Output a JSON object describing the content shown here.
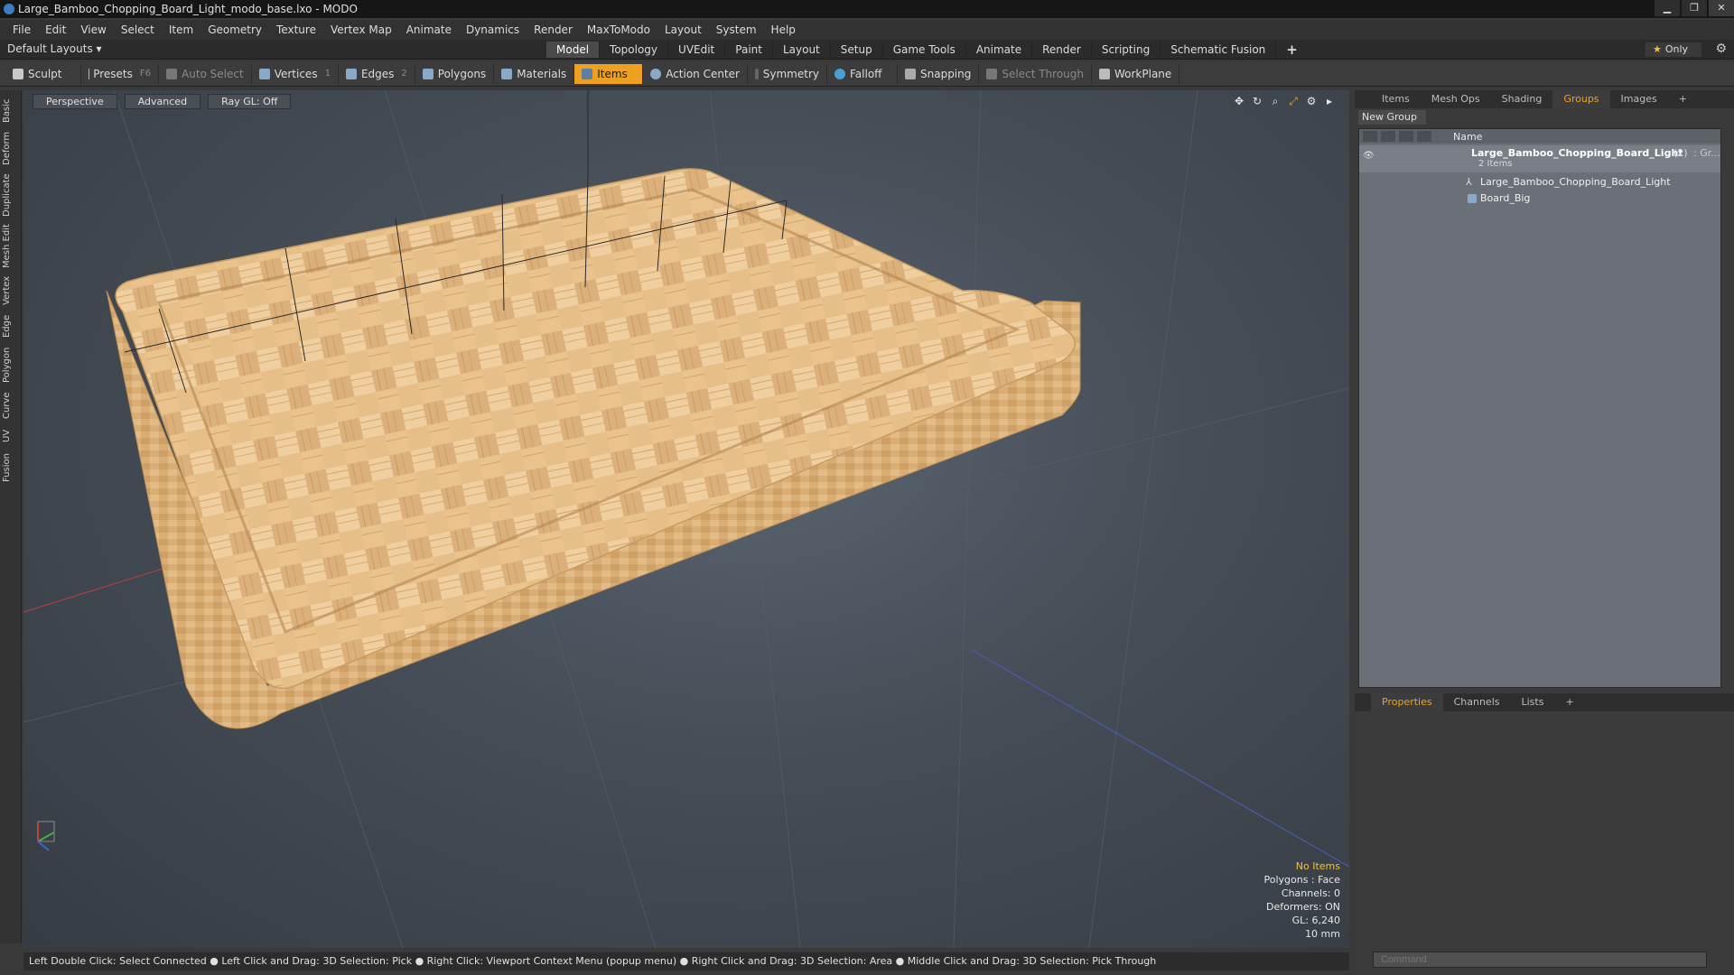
{
  "window": {
    "title": "Large_Bamboo_Chopping_Board_Light_modo_base.lxo - MODO",
    "minimize": "▁",
    "maximize": "❐",
    "close": "✕"
  },
  "menu": [
    "File",
    "Edit",
    "View",
    "Select",
    "Item",
    "Geometry",
    "Texture",
    "Vertex Map",
    "Animate",
    "Dynamics",
    "Render",
    "MaxToModo",
    "Layout",
    "System",
    "Help"
  ],
  "layout": {
    "selector": "Default Layouts ▾",
    "tabs": [
      "Model",
      "Topology",
      "UVEdit",
      "Paint",
      "Layout",
      "Setup",
      "Game Tools",
      "Animate",
      "Render",
      "Scripting",
      "Schematic Fusion"
    ],
    "active_tab": "Model",
    "add": "+",
    "only_star": "★",
    "only_label": "Only",
    "gear": "⚙"
  },
  "toolbar": {
    "sculpt": "Sculpt",
    "presets": "Presets",
    "presets_key": "F6",
    "auto_select": "Auto Select",
    "vertices": "Vertices",
    "vertices_count": "1",
    "edges": "Edges",
    "edges_count": "2",
    "polygons": "Polygons",
    "materials": "Materials",
    "items": "Items",
    "action_center": "Action Center",
    "symmetry": "Symmetry",
    "falloff": "Falloff",
    "snapping": "Snapping",
    "select_through": "Select Through",
    "workplane": "WorkPlane"
  },
  "left_tabs": [
    "Basic",
    "Deform",
    "Duplicate",
    "Mesh Edit",
    "Vertex",
    "Edge",
    "Polygon",
    "Curve",
    "UV",
    "Fusion"
  ],
  "viewport": {
    "view": "Perspective",
    "shading": "Advanced",
    "raygl": "Ray GL: Off",
    "icons": [
      "✥",
      "↻",
      "⌕",
      "⤢",
      "⚙",
      "▸"
    ],
    "info": {
      "selection": "No Items",
      "polygons": "Polygons : Face",
      "channels": "Channels: 0",
      "deformers": "Deformers: ON",
      "gl": "GL: 6,240",
      "scale": "10 mm"
    },
    "colors": {
      "bg": "#454d56",
      "wood_light": "#e8c28e",
      "wood_dark": "#c9995c"
    }
  },
  "status": "Left Double Click: Select Connected ● Left Click and Drag: 3D Selection: Pick ● Right Click: Viewport Context Menu (popup menu) ● Right Click and Drag: 3D Selection: Area ● Middle Click and Drag: 3D Selection: Pick Through",
  "right_panel": {
    "tabs": [
      "Items",
      "Mesh Ops",
      "Shading",
      "Groups",
      "Images",
      "+"
    ],
    "active_tab": "Groups",
    "new_group": "New Group",
    "column_name": "Name",
    "group": {
      "name": "Large_Bamboo_Chopping_Board_Light",
      "count": "(2)",
      "suffix": ": Gr...",
      "sub": "2 Items",
      "children": [
        "Large_Bamboo_Chopping_Board_Light",
        "Board_Big"
      ]
    }
  },
  "properties": {
    "tabs": [
      "Properties",
      "Channels",
      "Lists",
      "+"
    ],
    "active_tab": "Properties",
    "command_placeholder": "Command"
  }
}
